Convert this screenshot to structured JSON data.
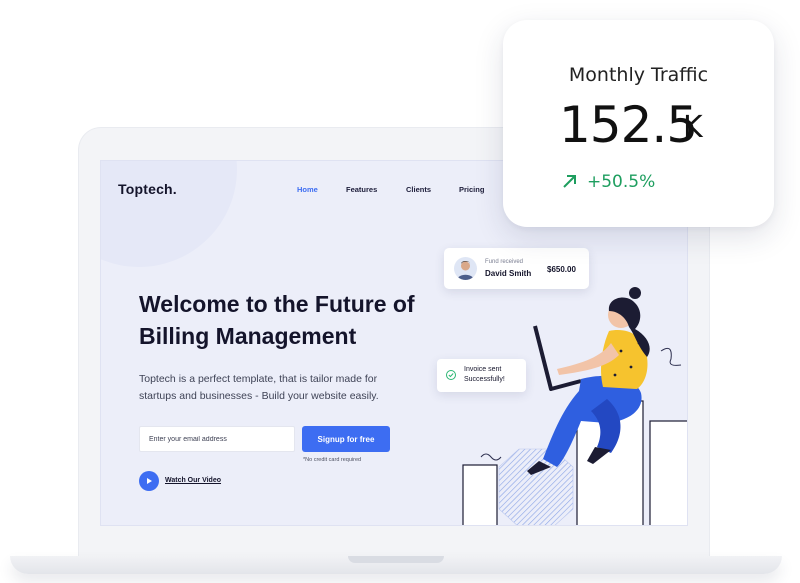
{
  "brand": {
    "name": "Toptech."
  },
  "nav": {
    "items": [
      "Home",
      "Features",
      "Clients",
      "Pricing"
    ],
    "active": "Home"
  },
  "hero": {
    "title": "Welcome to the Future of Billing Management",
    "subtitle": "Toptech is a perfect template, that is tailor made for startups and businesses - Build your website easily.",
    "email_placeholder": "Enter your email address",
    "signup_label": "Signup for free",
    "note": "*No credit card required",
    "watch_label": "Watch Our Video"
  },
  "fund_card": {
    "label": "Fund received",
    "name": "David Smith",
    "amount": "$650.00"
  },
  "invoice_card": {
    "line1": "Invoice sent",
    "line2": "Successfully!"
  },
  "traffic": {
    "title": "Monthly Traffic",
    "value": "152.5",
    "unit": "K",
    "change": "+50.5%"
  },
  "colors": {
    "accent": "#3d6df2",
    "positive": "#1e9e5f",
    "illustration_yellow": "#f6c32e",
    "illustration_dark": "#1c1c33"
  }
}
